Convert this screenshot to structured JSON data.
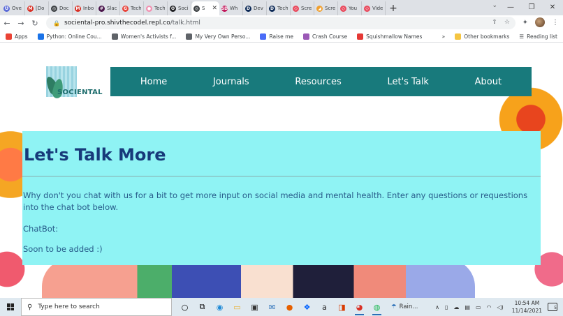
{
  "browser": {
    "tabs": [
      {
        "title": "Ove",
        "color": "#5b6bd8",
        "glyph": "Ʊ"
      },
      {
        "title": "[Do",
        "color": "#d93025",
        "glyph": "M"
      },
      {
        "title": "Doc",
        "color": "#3c4043",
        "glyph": "◎"
      },
      {
        "title": "Inbo",
        "color": "#d93025",
        "glyph": "M"
      },
      {
        "title": "Slac",
        "color": "#4a154b",
        "glyph": "#"
      },
      {
        "title": "Tech",
        "color": "#e8453c",
        "glyph": "G"
      },
      {
        "title": "Tech",
        "color": "#f28fb0",
        "glyph": "●"
      },
      {
        "title": "Soci",
        "color": "#202124",
        "glyph": "O"
      },
      {
        "title": "S",
        "color": "#3c4043",
        "glyph": "◎"
      },
      {
        "title": "Wh",
        "color": "#c2185b",
        "glyph": "SD"
      },
      {
        "title": "Dev",
        "color": "#0d2a57",
        "glyph": "D"
      },
      {
        "title": "Tech",
        "color": "#0d2a57",
        "glyph": "D"
      },
      {
        "title": "Scre",
        "color": "#e94b5e",
        "glyph": "◇"
      },
      {
        "title": "Scre",
        "color": "#f0a030",
        "glyph": "◢"
      },
      {
        "title": "You",
        "color": "#e94b5e",
        "glyph": "◇"
      },
      {
        "title": "Vide",
        "color": "#e94b5e",
        "glyph": "◇"
      }
    ],
    "active_tab_index": 8,
    "new_tab_glyph": "+",
    "url_host": "sociental-pro.shivthecodel.repl.co",
    "url_path": "/talk.html",
    "bookmarks": [
      {
        "label": "Apps",
        "color": "#ea4335"
      },
      {
        "label": "Python: Online Cou...",
        "color": "#1a73e8"
      },
      {
        "label": "Women's Activists f...",
        "color": "#5f6368"
      },
      {
        "label": "My Very Own Perso...",
        "color": "#5f6368"
      },
      {
        "label": "Raise me",
        "color": "#4a6cf7"
      },
      {
        "label": "Crash Course",
        "color": "#9b59b6"
      },
      {
        "label": "Squishmallow Names",
        "color": "#e53935"
      }
    ],
    "bookmarks_overflow": "»",
    "other_bookmarks": "Other bookmarks",
    "reading_list": "Reading list"
  },
  "site": {
    "logo_text": "SOCIENTAL",
    "nav": [
      "Home",
      "Journals",
      "Resources",
      "Let's Talk",
      "About"
    ],
    "heading": "Let's Talk More",
    "intro": "Why don't you chat with us for a bit to get more input on social media and mental health. Enter any questions or requestions into the chat bot below.",
    "chatbot_label": "ChatBot:",
    "soon": "Soon to be added :)"
  },
  "taskbar": {
    "search_placeholder": "Type here to search",
    "weather": "Rain...",
    "time": "10:54 AM",
    "date": "11/14/2021",
    "notifications": "5"
  }
}
